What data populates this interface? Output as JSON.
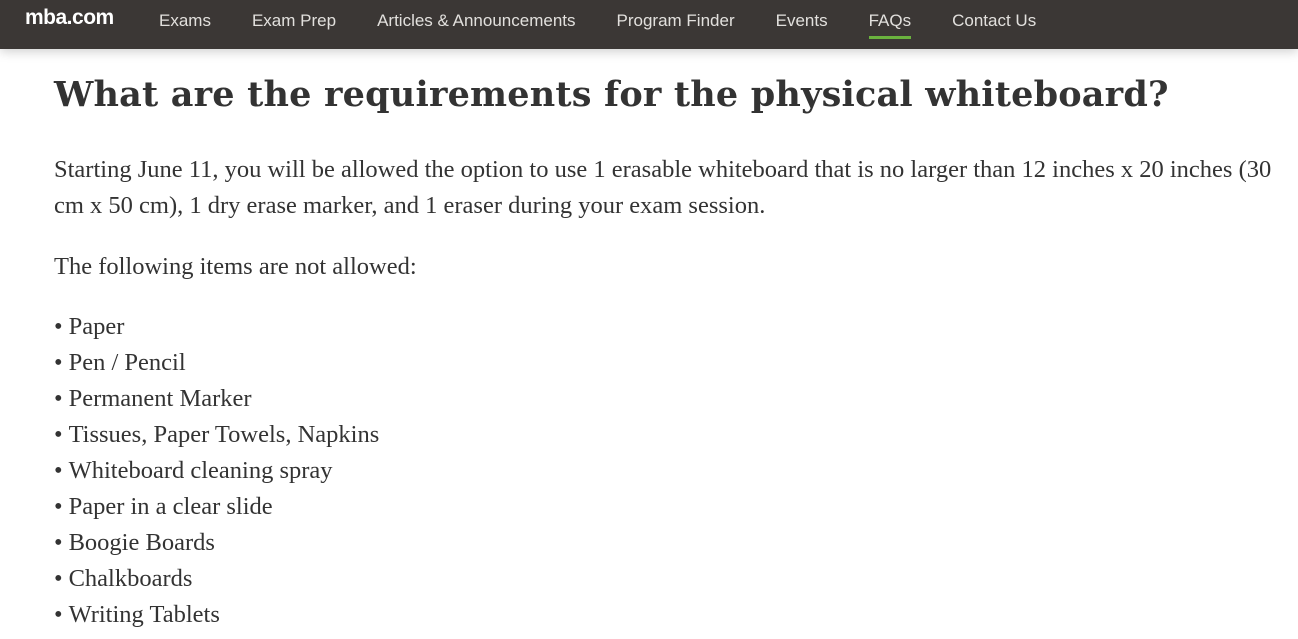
{
  "nav": {
    "logo": "mba.com",
    "items": [
      {
        "label": "Exams",
        "active": false
      },
      {
        "label": "Exam Prep",
        "active": false
      },
      {
        "label": "Articles & Announcements",
        "active": false
      },
      {
        "label": "Program Finder",
        "active": false
      },
      {
        "label": "Events",
        "active": false
      },
      {
        "label": "FAQs",
        "active": true
      },
      {
        "label": "Contact Us",
        "active": false
      }
    ],
    "active_underline_color": "#6ab23e",
    "background_color": "#3b3735"
  },
  "article": {
    "title": "What are the requirements for the physical whiteboard?",
    "intro": "Starting June 11, you will be allowed the option to use 1 erasable whiteboard that is no larger than 12 inches x 20 inches (30 cm x 50 cm), 1 dry erase marker, and 1 eraser during your exam session.",
    "not_allowed_heading": "The following items are not allowed:",
    "bullet_char": "•",
    "not_allowed_items": [
      "Paper",
      "Pen / Pencil",
      "Permanent Marker",
      "Tissues, Paper Towels, Napkins",
      "Whiteboard cleaning spray",
      "Paper in a clear slide",
      "Boogie Boards",
      "Chalkboards",
      "Writing Tablets"
    ]
  }
}
